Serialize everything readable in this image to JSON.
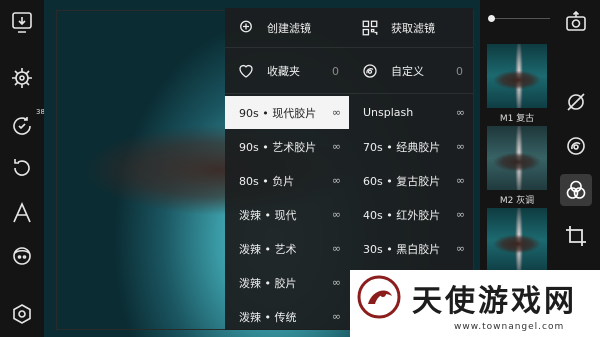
{
  "left_toolbar": {
    "history_badge": "38",
    "icons": [
      "import-photo-icon",
      "settings-wheel-icon",
      "history-icon",
      "undo-icon",
      "text-icon",
      "face-icon",
      "preferences-icon"
    ]
  },
  "filter_panel": {
    "header": {
      "create_label": "创建滤镜",
      "get_label": "获取滤镜",
      "favorites_label": "收藏夹",
      "favorites_count": "0",
      "custom_label": "自定义",
      "custom_count": "0"
    },
    "left_column": [
      {
        "label": "90s • 现代胶片",
        "count": "∞",
        "selected": true
      },
      {
        "label": "90s • 艺术胶片",
        "count": "∞"
      },
      {
        "label": "80s • 负片",
        "count": "∞"
      },
      {
        "label": "泼辣 • 现代",
        "count": "∞"
      },
      {
        "label": "泼辣 • 艺术",
        "count": "∞"
      },
      {
        "label": "泼辣 • 胶片",
        "count": "∞"
      },
      {
        "label": "泼辣 • 传统",
        "count": "∞"
      }
    ],
    "right_column": [
      {
        "label": "Unsplash",
        "count": "∞"
      },
      {
        "label": "70s • 经典胶片",
        "count": "∞"
      },
      {
        "label": "60s • 复古胶片",
        "count": "∞"
      },
      {
        "label": "40s • 红外胶片",
        "count": "∞"
      },
      {
        "label": "30s • 黑白胶片",
        "count": "∞"
      }
    ]
  },
  "presets": [
    {
      "label": "M1 复古"
    },
    {
      "label": "M2 灰调"
    }
  ],
  "right_toolbar": {
    "icons": [
      "export-icon",
      "remove-filter-icon",
      "mask-icon",
      "filter-icon",
      "crop-icon"
    ]
  },
  "watermark": {
    "text": "天使游戏网",
    "url": "www.townangel.com"
  }
}
